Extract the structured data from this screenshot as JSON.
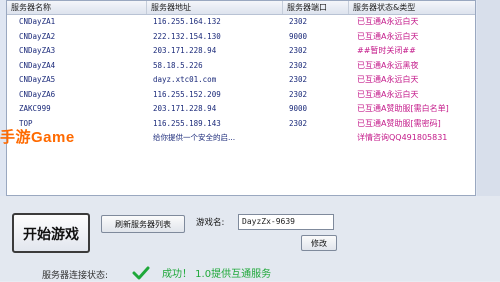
{
  "list": {
    "headers": {
      "name": "服务器名称",
      "address": "服务器地址",
      "port": "服务器端口",
      "status": "服务器状态&类型"
    },
    "rows": [
      {
        "name": "CNDayZA1",
        "address": "116.255.164.132",
        "port": "2302",
        "status": "已互通A永远白天"
      },
      {
        "name": "CNDayZA2",
        "address": "222.132.154.130",
        "port": "9000",
        "status": "已互通A永远白天"
      },
      {
        "name": "CNDayZA3",
        "address": "203.171.228.94",
        "port": "2302",
        "status": "##暂时关闭##"
      },
      {
        "name": "CNDayZA4",
        "address": "58.18.5.226",
        "port": "2302",
        "status": "已互通A永远黑夜"
      },
      {
        "name": "CNDayZA5",
        "address": "dayz.xtc01.com",
        "port": "2302",
        "status": "已互通A永远白天"
      },
      {
        "name": "CNDayZA6",
        "address": "116.255.152.209",
        "port": "2302",
        "status": "已互通A永远白天"
      },
      {
        "name": "ZAKC999",
        "address": "203.171.228.94",
        "port": "9000",
        "status": "已互通A赞助服[需白名单]"
      },
      {
        "name": "TOP",
        "address": "116.255.189.143",
        "port": "2302",
        "status": "已互通A赞助服[需密码]"
      },
      {
        "name": "",
        "address": "给你提供一个安全的启...",
        "port": "",
        "status": "详情咨询QQ491805831"
      }
    ]
  },
  "watermark": "手游Game",
  "controls": {
    "start_label": "开始游戏",
    "refresh_label": "刷新服务器列表",
    "account_label": "游戏名:",
    "account_value": "DayzZx-9639",
    "edit_label": "修改"
  },
  "footer": {
    "label": "服务器连接状态:",
    "message": "成功！ 1.0提供互通服务"
  },
  "colors": {
    "status": "#c41a8a",
    "text": "#1b2a7a",
    "watermark": "#ff6a00",
    "ok": "#1fa83a"
  }
}
